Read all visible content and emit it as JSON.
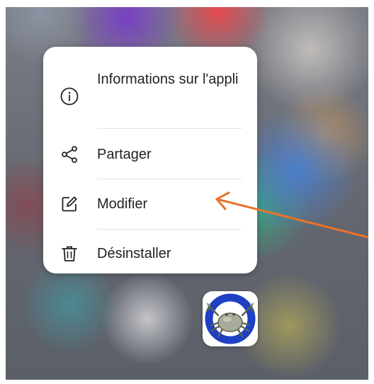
{
  "menu": {
    "items": [
      {
        "label": "Informations sur l'appli",
        "icon": "info-icon"
      },
      {
        "label": "Partager",
        "icon": "share-icon"
      },
      {
        "label": "Modifier",
        "icon": "edit-icon"
      },
      {
        "label": "Désinstaller",
        "icon": "trash-icon"
      }
    ]
  },
  "app": {
    "icon": "crab-app-icon"
  },
  "colors": {
    "menu_bg": "#ffffff",
    "menu_text": "#222222",
    "arrow": "#e8742a",
    "app_icon_blue": "#1f3fc4"
  }
}
